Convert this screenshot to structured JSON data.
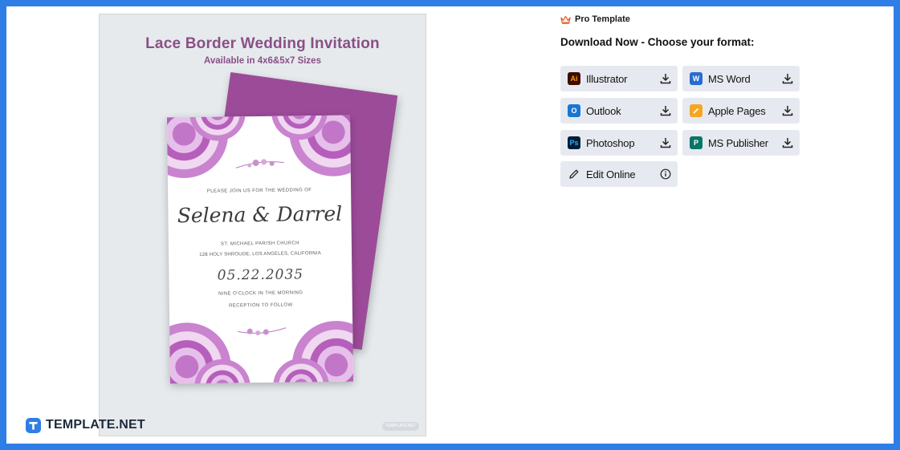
{
  "preview": {
    "title": "Lace Border Wedding Invitation",
    "subtitle": "Available in 4x6&5x7 Sizes",
    "card": {
      "intro": "PLEASE JOIN US FOR THE WEDDING OF",
      "names": "Selena & Darrel",
      "venue": "ST. MICHAEL PARISH CHURCH",
      "address": "128 HOLY SHROUDE, LOS ANGELES, CALIFORNIA",
      "date": "05.22.2035",
      "time": "NINE O'CLOCK IN THE MORNING",
      "reception": "RECEPTION TO FOLLOW"
    },
    "watermark": "TEMPLATE.NET"
  },
  "brand": {
    "name": "TEMPLATE.NET"
  },
  "pro_template": {
    "label": "Pro Template",
    "icon": "crown-icon"
  },
  "download_heading": "Download Now - Choose your format:",
  "formats": [
    {
      "label": "Illustrator",
      "icon": "illustrator-icon",
      "action_icon": "download-icon",
      "color": "#3b0d00",
      "glyph": "Ai"
    },
    {
      "label": "MS Word",
      "icon": "ms-word-icon",
      "action_icon": "download-icon",
      "color": "#2b6bd1",
      "glyph": "W"
    },
    {
      "label": "Outlook",
      "icon": "outlook-icon",
      "action_icon": "download-icon",
      "color": "#1976d2",
      "glyph": "O"
    },
    {
      "label": "Apple Pages",
      "icon": "apple-pages-icon",
      "action_icon": "download-icon",
      "color": "#f5a623",
      "glyph": "P"
    },
    {
      "label": "Photoshop",
      "icon": "photoshop-icon",
      "action_icon": "download-icon",
      "color": "#001e36",
      "glyph": "Ps"
    },
    {
      "label": "MS Publisher",
      "icon": "ms-publisher-icon",
      "action_icon": "download-icon",
      "color": "#077568",
      "glyph": "P"
    },
    {
      "label": "Edit Online",
      "icon": "pencil-icon",
      "action_icon": "info-icon"
    }
  ],
  "colors": {
    "frame": "#2e7ee6",
    "button_bg": "#e6eaf0",
    "title_purple": "#8a4f86",
    "envelope": "#9c4b98",
    "lace": "#c276c8",
    "crown": "#e8622c"
  }
}
